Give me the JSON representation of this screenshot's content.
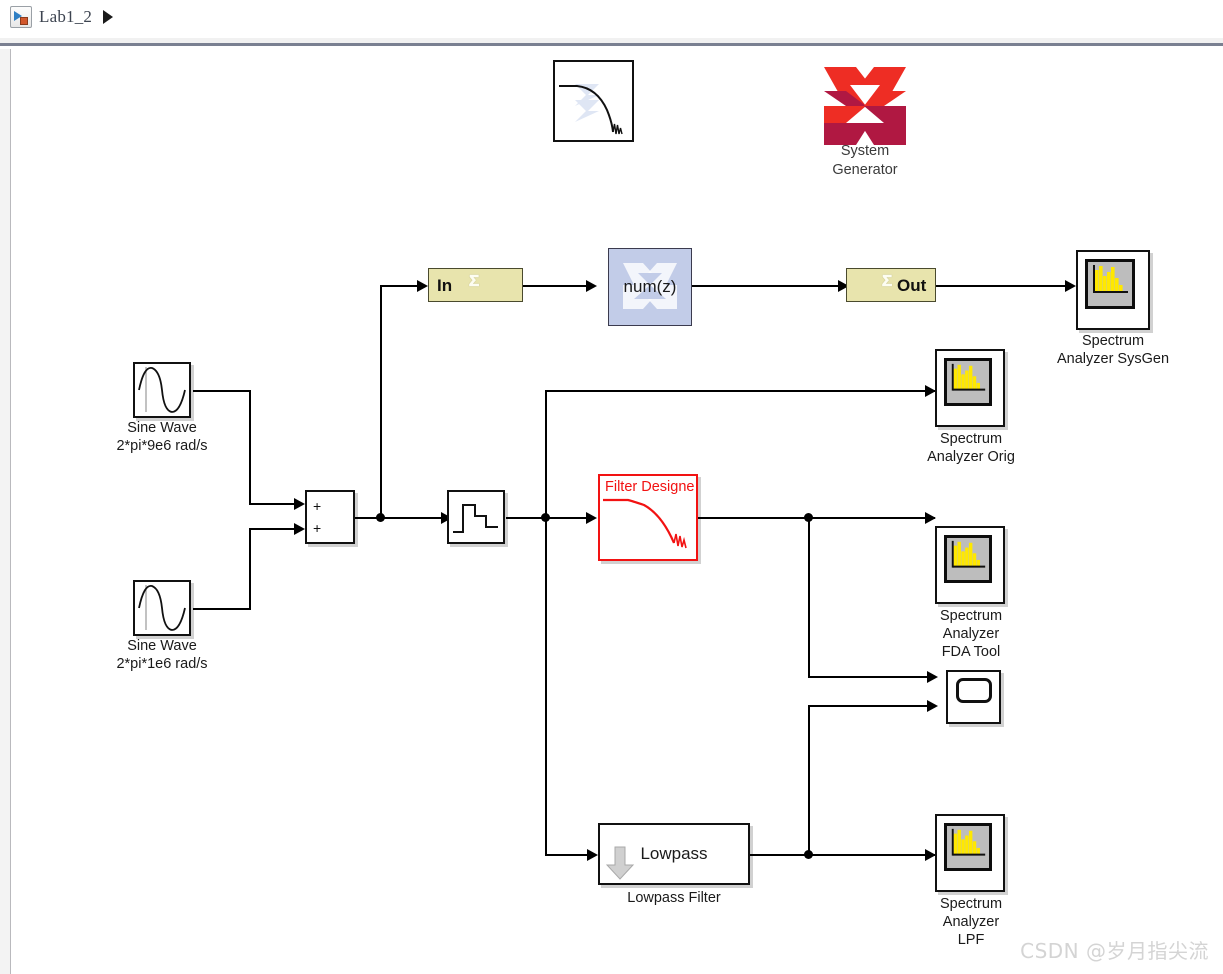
{
  "window": {
    "breadcrumb_label": "Lab1_2",
    "breadcrumb_icon": "simulink-model-icon",
    "breadcrumb_arrow_icon": "play-arrow-icon"
  },
  "watermark": {
    "text": "CSDN @岁月指尖流"
  },
  "model": {
    "title": "Lab1_2",
    "blocks": [
      {
        "id": "filter_design_icon_top",
        "type": "xilinx-filter-icon",
        "label": "",
        "icon": "filter-response-icon"
      },
      {
        "id": "system_generator",
        "type": "xilinx-system-generator",
        "label": "System\nGenerator",
        "icon": "xilinx-logo-icon"
      },
      {
        "id": "sine_wave_1",
        "type": "sine-wave",
        "label": "Sine Wave\n2*pi*9e6 rad/s",
        "icon": "sine-wave-icon"
      },
      {
        "id": "sine_wave_2",
        "type": "sine-wave",
        "label": "Sine Wave\n2*pi*1e6 rad/s",
        "icon": "sine-wave-icon"
      },
      {
        "id": "sum",
        "type": "sum",
        "label": "",
        "signs": [
          "+",
          "+"
        ],
        "icon": "sum-icon"
      },
      {
        "id": "quantizer",
        "type": "quantizer",
        "label": "",
        "icon": "staircase-icon"
      },
      {
        "id": "gateway_in",
        "type": "xilinx-gateway-in",
        "label": "In",
        "icon": "xilinx-sigma-icon"
      },
      {
        "id": "fir_compiler",
        "type": "xilinx-fir",
        "label": "num(z)",
        "icon": "xilinx-watermark-icon"
      },
      {
        "id": "gateway_out",
        "type": "xilinx-gateway-out",
        "label": "Out",
        "icon": "xilinx-sigma-icon"
      },
      {
        "id": "spectrum_sysgen",
        "type": "spectrum-analyzer",
        "label": "Spectrum\nAnalyzer SysGen",
        "icon": "spectrum-icon"
      },
      {
        "id": "spectrum_orig",
        "type": "spectrum-analyzer",
        "label": "Spectrum\nAnalyzer Orig",
        "icon": "spectrum-icon"
      },
      {
        "id": "filter_designer",
        "type": "filter-designer",
        "label": "Filter Designe",
        "icon": "filter-response-icon",
        "color": "#f21212"
      },
      {
        "id": "spectrum_fda",
        "type": "spectrum-analyzer",
        "label": "Spectrum\nAnalyzer\nFDA Tool",
        "icon": "spectrum-icon"
      },
      {
        "id": "scope",
        "type": "scope",
        "label": "",
        "icon": "scope-icon"
      },
      {
        "id": "lowpass_filter",
        "type": "lowpass-filter",
        "label": "Lowpass Filter",
        "inner_label": "Lowpass",
        "icon": "down-arrow-icon"
      },
      {
        "id": "spectrum_lpf",
        "type": "spectrum-analyzer",
        "label": "Spectrum\nAnalyzer\nLPF",
        "icon": "spectrum-icon"
      }
    ]
  },
  "colors": {
    "gateway_fill": "#e8e4ad",
    "fir_fill": "#c2cce8",
    "filter_designer_stroke": "#f21212",
    "spectrum_bar": "#ffe800",
    "spectrum_panel": "#bdbdbd",
    "xilinx_red": "#ee2d24",
    "xilinx_crimson": "#b01842",
    "wire": "#000000"
  }
}
